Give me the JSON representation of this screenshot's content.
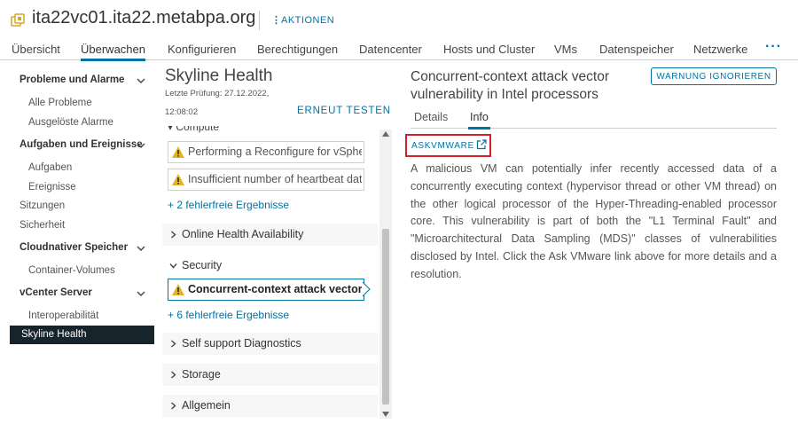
{
  "header": {
    "title": "ita22vc01.ita22.metabpa.org",
    "actions_label": "AKTIONEN"
  },
  "tabs": [
    {
      "label": "Übersicht"
    },
    {
      "label": "Überwachen",
      "active": true
    },
    {
      "label": "Konfigurieren"
    },
    {
      "label": "Berechtigungen"
    },
    {
      "label": "Datencenter"
    },
    {
      "label": "Hosts und Cluster"
    },
    {
      "label": "VMs"
    },
    {
      "label": "Datenspeicher"
    },
    {
      "label": "Netzwerke"
    }
  ],
  "tabs_more": "···",
  "leftnav": {
    "groups": [
      {
        "label": "Probleme und Alarme",
        "items": [
          "Alle Probleme",
          "Ausgelöste Alarme"
        ]
      },
      {
        "label": "Aufgaben und Ereignisse",
        "items": [
          "Aufgaben",
          "Ereignisse"
        ]
      },
      {
        "label": "Cloudnativer Speicher",
        "items": [
          "Container-Volumes"
        ]
      },
      {
        "label": "vCenter Server",
        "items": [
          "Interoperabilität"
        ]
      }
    ],
    "top_items": [
      "Sitzungen",
      "Sicherheit"
    ],
    "selected": "Skyline Health"
  },
  "middle": {
    "title": "Skyline Health",
    "last_check_label": "Letzte Prüfung: 27.12.2022,",
    "last_check_time": "12:08:02",
    "retest_label": "ERNEUT TESTEN",
    "compute_label": "Compute",
    "compute_findings": [
      "Performing a Reconfigure for vSphere HA on the host",
      "Insufficient number of heartbeat datastores"
    ],
    "compute_ok_link": "+ 2 fehlerfreie Ergebnisse",
    "online_health": "Online Health Availability",
    "security_label": "Security",
    "security_finding": "Concurrent-context attack vector vulnerability in Intel processors",
    "security_ok_link": "+ 6 fehlerfreie Ergebnisse",
    "self_support": "Self support Diagnostics",
    "storage": "Storage",
    "general": "Allgemein"
  },
  "detail": {
    "title": "Concurrent-context attack vector vulnerability in Intel processors",
    "ignore_button": "WARNUNG IGNORIEREN",
    "tabs": [
      "Details",
      "Info"
    ],
    "active_tab": "Info",
    "ask_link": "ASKVMWARE",
    "description": "A malicious VM can potentially infer recently accessed data of a concurrently executing context (hypervisor thread or other VM thread) on the other logical processor of the Hyper-Threading-enabled processor core. This vulnerability is part of both the \"L1 Terminal Fault\" and \"Microarchitectural Data Sampling (MDS)\" classes of vulnerabilities disclosed by Intel. Click the Ask VMware link above for more details and a resolution."
  },
  "colors": {
    "accent": "#0072a3",
    "warning": "#e5b322",
    "selected_nav_bg": "#17242b",
    "highlight_box": "#d4202a"
  }
}
